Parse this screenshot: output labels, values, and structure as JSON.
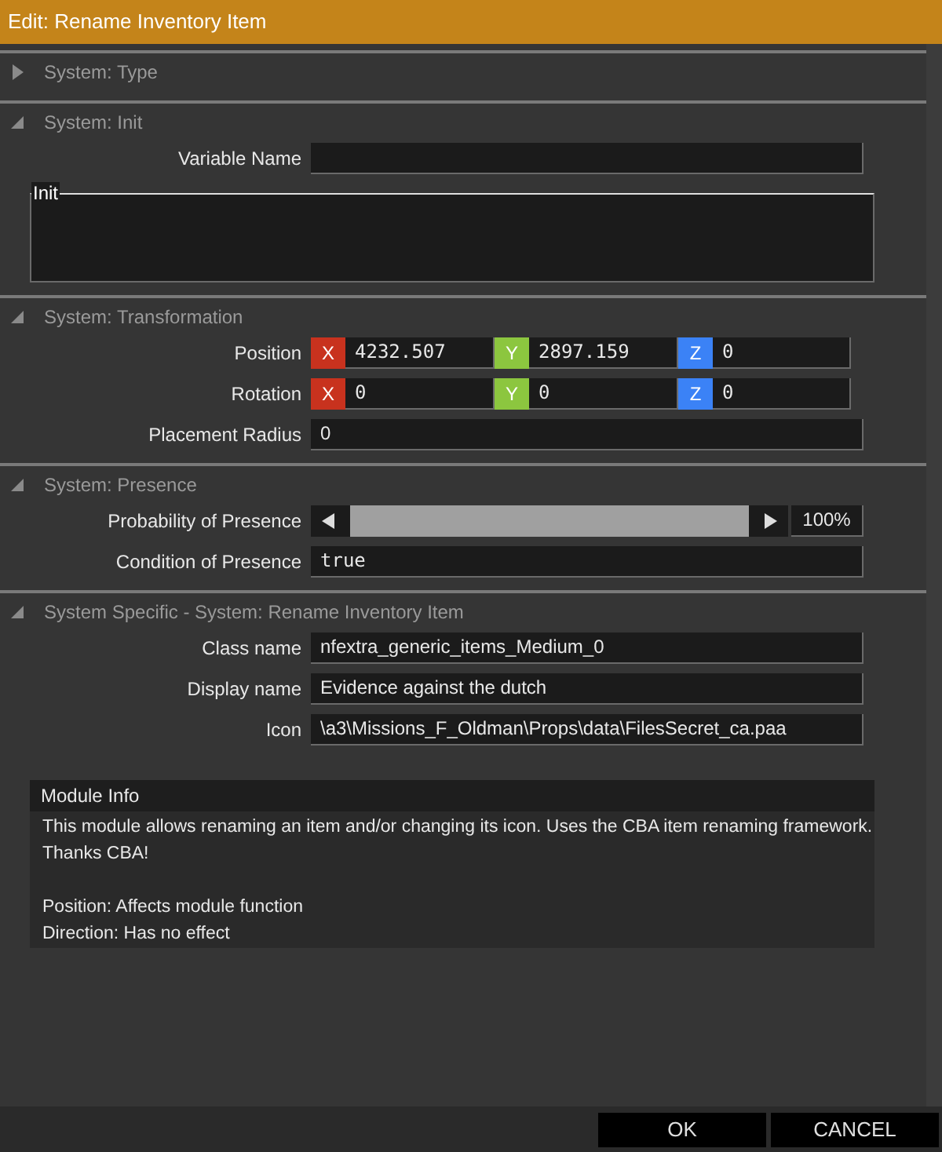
{
  "window": {
    "title": "Edit: Rename Inventory Item"
  },
  "sections": [
    {
      "title": "System: Type",
      "expanded": false
    },
    {
      "title": "System: Init",
      "expanded": true,
      "rows": [
        {
          "kind": "text",
          "label": "Variable Name"
        },
        {
          "kind": "textarea",
          "label": "Init"
        }
      ]
    },
    {
      "title": "System: Transformation",
      "expanded": true,
      "rows": [
        {
          "kind": "xyz",
          "label": "Position",
          "axes": [
            {
              "axis": "X",
              "value": "4232.507"
            },
            {
              "axis": "Y",
              "value": "2897.159"
            },
            {
              "axis": "Z",
              "value": "0"
            }
          ]
        },
        {
          "kind": "xyz",
          "label": "Rotation",
          "axes": [
            {
              "axis": "X",
              "value": "0"
            },
            {
              "axis": "Y",
              "value": "0"
            },
            {
              "axis": "Z",
              "value": "0"
            }
          ]
        },
        {
          "kind": "text",
          "label": "Placement Radius",
          "value": "0"
        }
      ]
    },
    {
      "title": "System: Presence",
      "expanded": true,
      "rows": [
        {
          "kind": "slider",
          "label": "Probability of Presence",
          "level": 1,
          "reading": "100%"
        },
        {
          "kind": "code",
          "label": "Condition of Presence",
          "value": "true"
        }
      ]
    },
    {
      "title": "System Specific - System: Rename Inventory Item",
      "expanded": true,
      "rows": [
        {
          "kind": "text",
          "label": "Class name",
          "value": "nfextra_generic_items_Medium_0"
        },
        {
          "kind": "text",
          "label": "Display name",
          "value": "Evidence against the dutch"
        },
        {
          "kind": "text",
          "label": "Icon",
          "value": "\\a3\\Missions_F_Oldman\\Props\\data\\FilesSecret_ca.paa"
        }
      ]
    }
  ],
  "module_info": {
    "title": "Module Info",
    "paragraphs": [
      [
        "This module allows renaming an item and/or changing its icon. Uses the CBA item renaming framework.",
        "Thanks CBA!"
      ],
      [
        "Position: Affects module function",
        "Direction: Has no effect"
      ]
    ]
  },
  "buttons": [
    "OK",
    "CANCEL"
  ]
}
